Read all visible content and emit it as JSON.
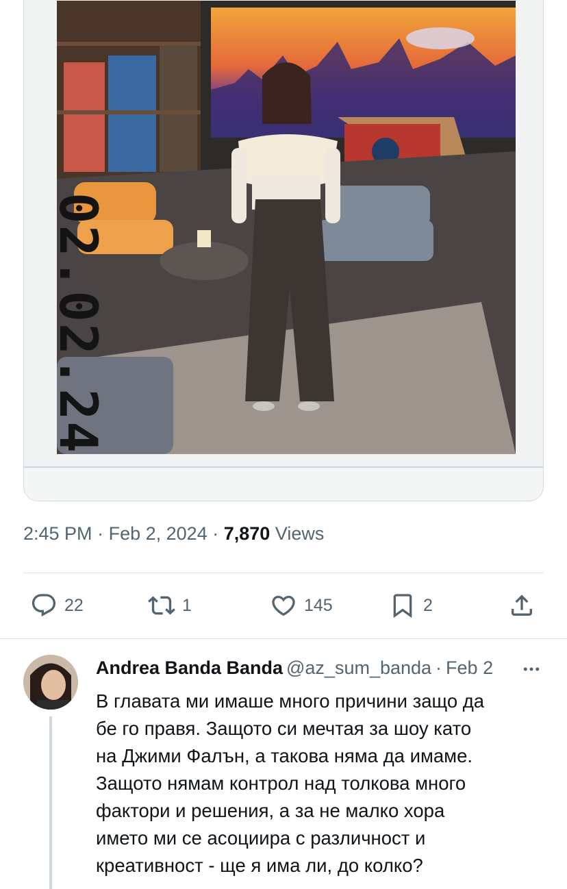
{
  "post": {
    "photo_stamp": "02.02.24",
    "time": "2:45 PM",
    "separator": "·",
    "date": "Feb 2, 2024",
    "views_count": "7,870",
    "views_label": "Views"
  },
  "actions": {
    "reply": {
      "icon": "comment-icon",
      "count": "22"
    },
    "repost": {
      "icon": "repost-icon",
      "count": "1"
    },
    "like": {
      "icon": "heart-icon",
      "count": "145"
    },
    "bookmark": {
      "icon": "bookmark-icon",
      "count": "2"
    },
    "share": {
      "icon": "share-icon"
    }
  },
  "reply": {
    "author_name": "Andrea Banda Banda",
    "handle": "@az_sum_banda",
    "separator": "·",
    "date": "Feb 2",
    "more_icon": "more-horizontal-icon",
    "lines": [
      "В главата ми имаше много причини защо да",
      "бе го правя. Защото си мечтая за шоу като",
      "на Джими Фалън, а такова няма да имаме.",
      "Защото нямам контрол над толкова много",
      "фактори и решения, а за не малко хора",
      "името ми се асоциира с различност и",
      "креативност - ще я има ли, до колко?"
    ]
  },
  "colors": {
    "text": "#0f1419",
    "secondary": "#536471",
    "divider": "#e1e6ea"
  }
}
